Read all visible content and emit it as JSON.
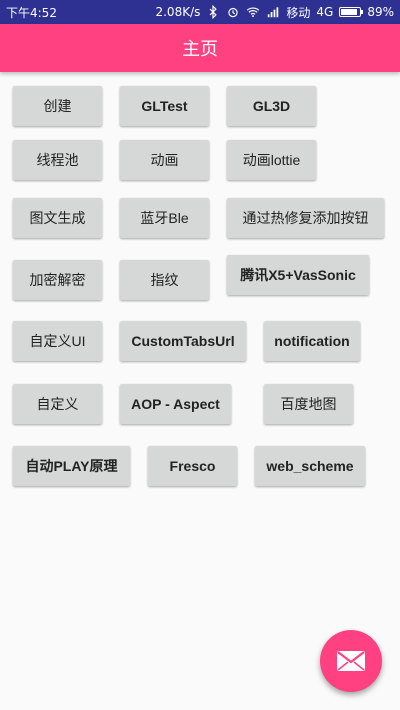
{
  "status_bar": {
    "time": "下午4:52",
    "net_speed": "2.08K/s",
    "carrier": "移动",
    "network": "4G",
    "battery": "89%",
    "battery_level": 0.89
  },
  "app_bar": {
    "title": "主页"
  },
  "buttons": {
    "create": "创建",
    "gltest": "GLTest",
    "gl3d": "GL3D",
    "threadpool": "线程池",
    "animation": "动画",
    "animation_lottie": "动画lottie",
    "image_text_gen": "图文生成",
    "bluetooth_ble": "蓝牙Ble",
    "hotfix_add_button": "通过热修复添加按钮",
    "encrypt_decrypt": "加密解密",
    "fingerprint": "指纹",
    "tencent_x5": "腾讯X5+VasSonic",
    "custom_ui": "自定义UI",
    "custom_tabs_url": "CustomTabsUrl",
    "notification": "notification",
    "custom": "自定义",
    "aop_aspect": "AOP - Aspect",
    "baidu_map": "百度地图",
    "auto_play": "自动PLAY原理",
    "fresco": "Fresco",
    "web_scheme": "web_scheme"
  },
  "fab": {
    "icon": "mail-icon"
  },
  "colors": {
    "accent": "#ff4081",
    "status_bar": "#2e3192",
    "button": "#d6d7d7"
  }
}
